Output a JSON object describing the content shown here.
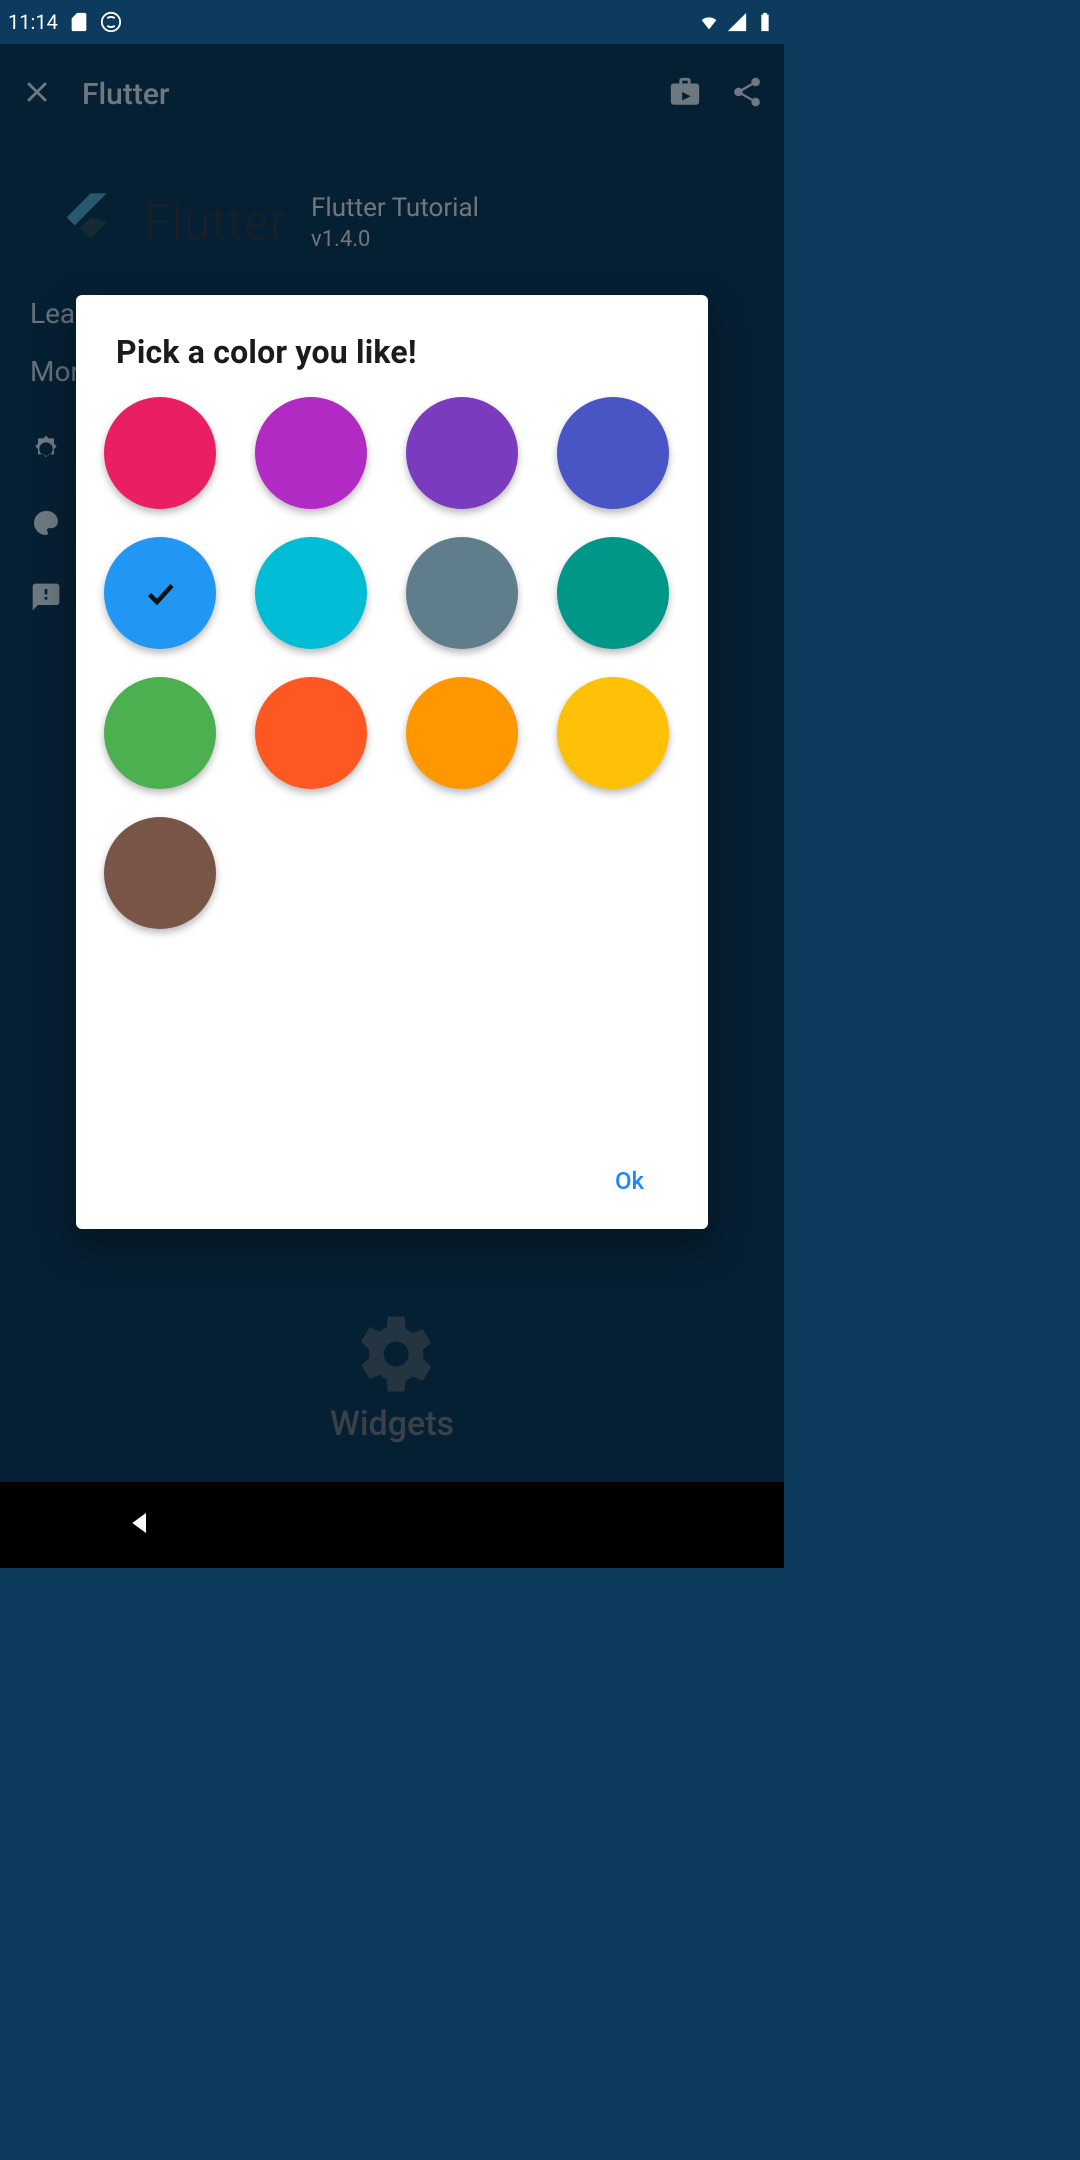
{
  "status": {
    "time": "11:14"
  },
  "appbar": {
    "title": "Flutter"
  },
  "header": {
    "logo_text": "Flutter",
    "title": "Flutter Tutorial",
    "version": "v1.4.0"
  },
  "desc": {
    "line1": "Learn cross platform app development for beginners.",
    "line2": "More coming soon."
  },
  "dialog": {
    "title": "Pick a color you like!",
    "ok_label": "Ok",
    "colors": [
      {
        "name": "pink",
        "hex": "#e91e63",
        "selected": false
      },
      {
        "name": "purple",
        "hex": "#b12ac4",
        "selected": false
      },
      {
        "name": "deep-purple",
        "hex": "#7a3bbf",
        "selected": false
      },
      {
        "name": "indigo",
        "hex": "#4a55c5",
        "selected": false
      },
      {
        "name": "blue",
        "hex": "#2196f3",
        "selected": true
      },
      {
        "name": "cyan",
        "hex": "#00bcd4",
        "selected": false
      },
      {
        "name": "blue-grey",
        "hex": "#607d8b",
        "selected": false
      },
      {
        "name": "teal",
        "hex": "#009688",
        "selected": false
      },
      {
        "name": "green",
        "hex": "#4caf50",
        "selected": false
      },
      {
        "name": "deep-orange",
        "hex": "#ff5722",
        "selected": false
      },
      {
        "name": "orange",
        "hex": "#ff9800",
        "selected": false
      },
      {
        "name": "amber",
        "hex": "#ffc107",
        "selected": false
      },
      {
        "name": "brown",
        "hex": "#795548",
        "selected": false
      }
    ]
  },
  "widgets_card": {
    "label": "Widgets"
  }
}
